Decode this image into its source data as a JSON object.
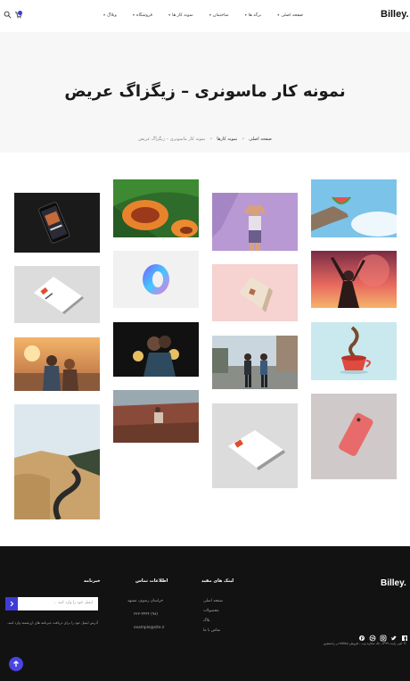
{
  "brand": {
    "logo": "Billey."
  },
  "nav": [
    {
      "label": "صفحه اصلی"
    },
    {
      "label": "برگه ها"
    },
    {
      "label": "ساختمان"
    },
    {
      "label": "نمونه کار ها"
    },
    {
      "label": "فروشگاه"
    },
    {
      "label": "وبلاگ"
    }
  ],
  "hero": {
    "title": "نمونه کار ماسونری – زیگزاگ عریض",
    "breadcrumb": [
      "صفحه اصلی",
      "نمونه کارها",
      "نمونه کار ماسونری – زیگزاگ عریض"
    ]
  },
  "gallery": {
    "tiles": [
      {
        "name": "phone-on-dark-photo"
      },
      {
        "name": "papaya-photo"
      },
      {
        "name": "woman-purple-photo"
      },
      {
        "name": "watermelon-sky-photo"
      },
      {
        "name": "card-mockup-photo"
      },
      {
        "name": "holographic-ring-photo"
      },
      {
        "name": "box-pink-photo"
      },
      {
        "name": "girl-sunset-photo"
      },
      {
        "name": "couple-sunset-photo"
      },
      {
        "name": "sparklers-photo"
      },
      {
        "name": "couple-street-photo"
      },
      {
        "name": "cup-splash-photo"
      },
      {
        "name": "road-hills-photo"
      },
      {
        "name": "couple-field-photo"
      },
      {
        "name": "card-mockup-2-photo"
      },
      {
        "name": "pink-phone-photo"
      }
    ]
  },
  "footer": {
    "logo": "Billey.",
    "copyright": "© کپی رایت ۱۳۹۹، تک ستاره وب - فروش billey در راستچین",
    "links_title": "لینک های مفید",
    "links": [
      "صفحه اصلی",
      "محصولات",
      "بلاگ",
      "تماس با ما"
    ],
    "contact_title": "اطلاعات تماس",
    "contact": [
      "خراسان رضوی، مشهد",
      "(۹۸) ۳۳۳-۴۴۴۴",
      "example@site.ir"
    ],
    "newsletter_title": "خبرنامه",
    "newsletter_placeholder": "ایمیل خود را وارد کنید ...",
    "newsletter_desc": "آدرس ایمیل خود را برای دریافت خبرنامه های ارزشمند وارد کنید."
  }
}
